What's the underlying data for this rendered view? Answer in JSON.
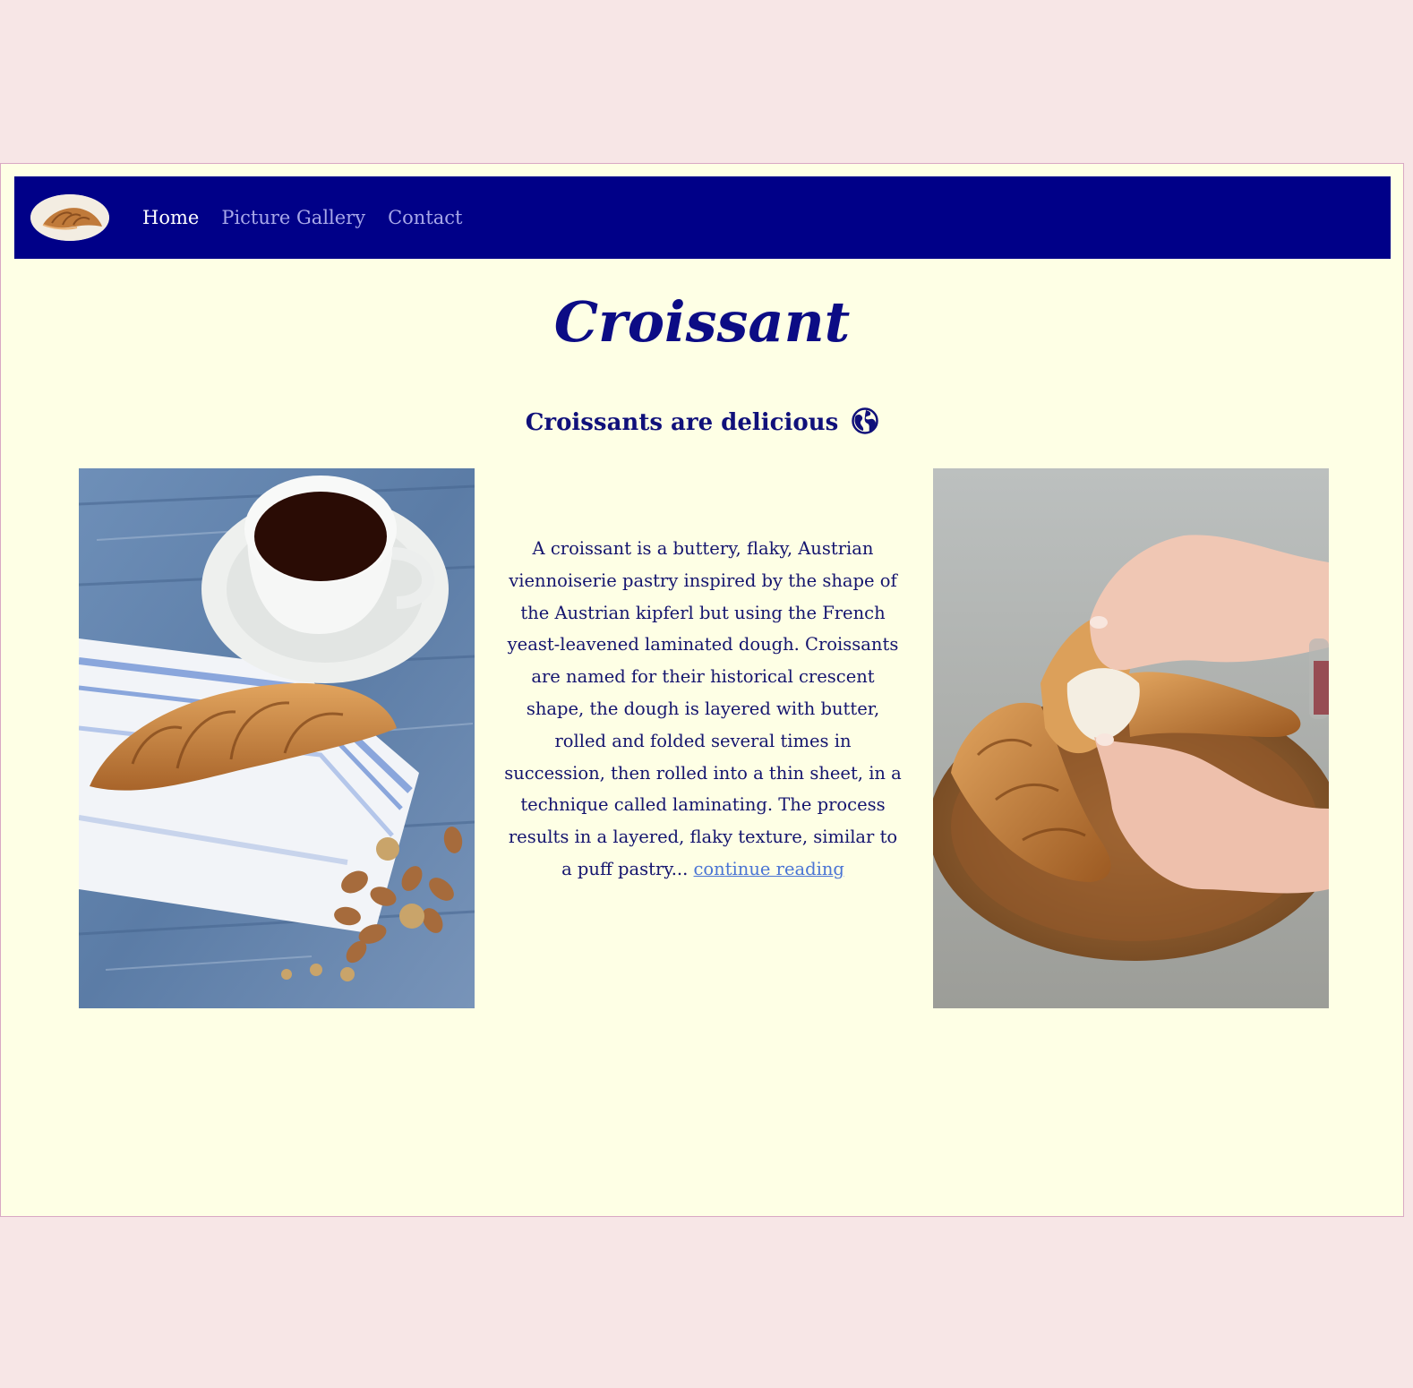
{
  "nav": {
    "logo_alt": "croissant logo",
    "links": [
      {
        "label": "Home",
        "active": true
      },
      {
        "label": "Picture Gallery",
        "active": false
      },
      {
        "label": "Contact",
        "active": false
      }
    ]
  },
  "hero": {
    "title": "Croissant",
    "subtitle": "Croissants are delicious",
    "subtitle_icon": "globe-icon"
  },
  "content": {
    "left_photo": "croissant-with-coffee-and-nuts-photo",
    "right_photo": "hands-tearing-croissant-photo",
    "intro_text": "A croissant is a buttery, flaky, Austrian viennoiserie pastry inspired by the shape of the Austrian kipferl but using the French yeast-leavened laminated dough. Croissants are named for their historical crescent shape, the dough is layered with butter, rolled and folded several times in succession, then rolled into a thin sheet, in a technique called laminating. The process results in a layered, flaky texture, similar to a puff pastry...",
    "read_more": "continue reading"
  },
  "colors": {
    "navbar": "#000088",
    "background": "#feffe5",
    "outer": "#f7e6e6",
    "text": "#14146e",
    "link": "#4a74d4"
  }
}
